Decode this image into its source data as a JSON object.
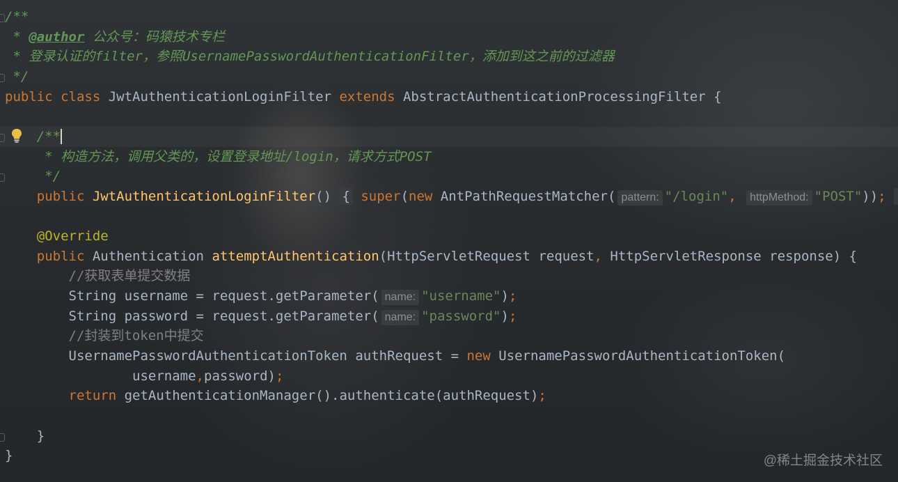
{
  "editor": {
    "lines": [
      [
        {
          "t": "/**",
          "c": "c-doc"
        }
      ],
      [
        {
          "t": " * ",
          "c": "c-doc"
        },
        {
          "t": "@author",
          "c": "c-tag"
        },
        {
          "t": " 公众号：码猿技术专栏",
          "c": "c-doc"
        }
      ],
      [
        {
          "t": " * 登录认证的filter，参照UsernamePasswordAuthenticationFilter，添加到这之前的过滤器",
          "c": "c-doc"
        }
      ],
      [
        {
          "t": " */",
          "c": "c-doc"
        }
      ],
      [
        {
          "t": "public class ",
          "c": "c-kw"
        },
        {
          "t": "JwtAuthenticationLoginFilter ",
          "c": "c-plain"
        },
        {
          "t": "extends ",
          "c": "c-kw"
        },
        {
          "t": "AbstractAuthenticationProcessingFilter {",
          "c": "c-plain"
        }
      ],
      [],
      [
        {
          "t": "    /**",
          "c": "c-doc"
        },
        {
          "caret": true
        }
      ],
      [
        {
          "t": "     * 构造方法，调用父类的，设置登录地址/login，请求方式POST",
          "c": "c-doc"
        }
      ],
      [
        {
          "t": "     */",
          "c": "c-doc"
        }
      ],
      [
        {
          "t": "    public ",
          "c": "c-kw"
        },
        {
          "t": "JwtAuthenticationLoginFilter",
          "c": "c-fn"
        },
        {
          "t": "() ",
          "c": "c-plain"
        },
        {
          "t": "{",
          "c": "c-plain",
          "box": true
        },
        {
          "t": " super",
          "c": "c-kw"
        },
        {
          "t": "(",
          "c": "c-plain"
        },
        {
          "t": "new ",
          "c": "c-kw"
        },
        {
          "t": "AntPathRequestMatcher(",
          "c": "c-plain"
        },
        {
          "hint": "pattern:"
        },
        {
          "t": "\"/login\"",
          "c": "c-str"
        },
        {
          "t": ", ",
          "c": "c-kw"
        },
        {
          "hint": "httpMethod:"
        },
        {
          "t": "\"POST\"",
          "c": "c-str"
        },
        {
          "t": "))",
          "c": "c-plain"
        },
        {
          "t": "; ",
          "c": "c-kw"
        },
        {
          "t": "}",
          "c": "c-plain",
          "box": true
        }
      ],
      [],
      [
        {
          "t": "    @Override",
          "c": "c-ann"
        }
      ],
      [
        {
          "t": "    public ",
          "c": "c-kw"
        },
        {
          "t": "Authentication ",
          "c": "c-plain"
        },
        {
          "t": "attemptAuthentication",
          "c": "c-fn"
        },
        {
          "t": "(HttpServletRequest request",
          "c": "c-plain"
        },
        {
          "t": ", ",
          "c": "c-kw"
        },
        {
          "t": "HttpServletResponse response) {",
          "c": "c-plain"
        }
      ],
      [
        {
          "t": "        //获取表单提交数据",
          "c": "c-cmt"
        }
      ],
      [
        {
          "t": "        String username = request.getParameter(",
          "c": "c-plain"
        },
        {
          "hint": "name:"
        },
        {
          "t": "\"username\"",
          "c": "c-str"
        },
        {
          "t": ")",
          "c": "c-plain"
        },
        {
          "t": ";",
          "c": "c-kw"
        }
      ],
      [
        {
          "t": "        String password = request.getParameter(",
          "c": "c-plain"
        },
        {
          "hint": "name:"
        },
        {
          "t": "\"password\"",
          "c": "c-str"
        },
        {
          "t": ")",
          "c": "c-plain"
        },
        {
          "t": ";",
          "c": "c-kw"
        }
      ],
      [
        {
          "t": "        //封装到token中提交",
          "c": "c-cmt"
        }
      ],
      [
        {
          "t": "        UsernamePasswordAuthenticationToken authRequest = ",
          "c": "c-plain"
        },
        {
          "t": "new ",
          "c": "c-kw"
        },
        {
          "t": "UsernamePasswordAuthenticationToken(",
          "c": "c-plain"
        }
      ],
      [
        {
          "t": "                username",
          "c": "c-plain"
        },
        {
          "t": ",",
          "c": "c-kw"
        },
        {
          "t": "password)",
          "c": "c-plain"
        },
        {
          "t": ";",
          "c": "c-kw"
        }
      ],
      [
        {
          "t": "        return ",
          "c": "c-kw"
        },
        {
          "t": "getAuthenticationManager().authenticate(authRequest)",
          "c": "c-plain"
        },
        {
          "t": ";",
          "c": "c-kw"
        }
      ],
      [],
      [
        {
          "t": "    }",
          "c": "c-plain"
        }
      ],
      [
        {
          "t": "}",
          "c": "c-plain"
        }
      ]
    ],
    "intention_icon": "lightbulb-icon"
  },
  "watermark": "@稀土掘金技术社区"
}
